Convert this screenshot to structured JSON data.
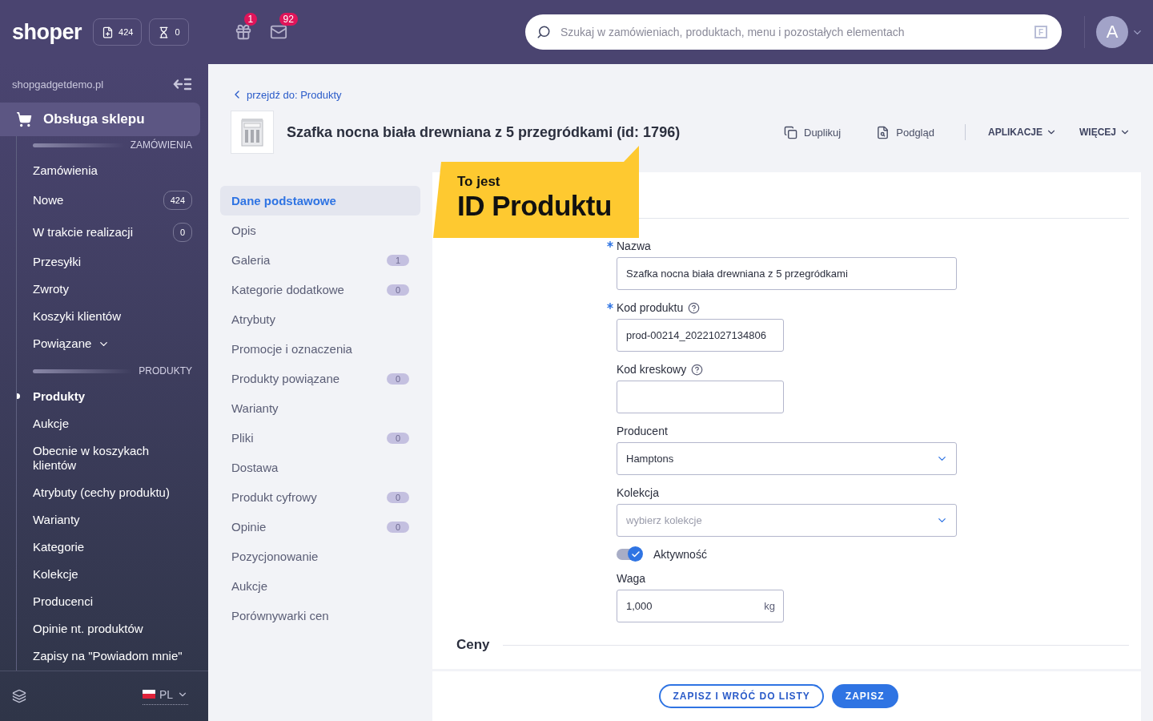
{
  "topbar": {
    "logo": "shoper",
    "counters": [
      {
        "kind": "orders",
        "count": "424"
      },
      {
        "kind": "pending",
        "count": "0"
      }
    ],
    "notifications": [
      {
        "kind": "gift",
        "badge": "1"
      },
      {
        "kind": "mail",
        "badge": "92"
      }
    ],
    "search": {
      "placeholder": "Szukaj w zamówieniach, produktach, menu i pozostałych elementach",
      "shortcut": "F"
    },
    "avatar": "A"
  },
  "sidebar": {
    "shop": "shopgadgetdemo.pl",
    "section": "Obsługa sklepu",
    "groups": [
      {
        "heading": "ZAMÓWIENIA",
        "items": [
          {
            "label": "Zamówienia",
            "selected": false
          },
          {
            "label": "Nowe",
            "badge": "424",
            "selected": false
          },
          {
            "label": "W trakcie realizacji",
            "badge": "0",
            "selected": false
          },
          {
            "label": "Przesyłki",
            "selected": false
          },
          {
            "label": "Zwroty",
            "selected": false
          },
          {
            "label": "Koszyki klientów",
            "selected": false
          },
          {
            "label": "Powiązane",
            "expandable": true,
            "selected": false
          }
        ]
      },
      {
        "heading": "PRODUKTY",
        "items": [
          {
            "label": "Produkty",
            "selected": true
          },
          {
            "label": "Aukcje",
            "selected": false
          },
          {
            "label": "Obecnie w koszykach klientów",
            "selected": false
          },
          {
            "label": "Atrybuty (cechy produktu)",
            "selected": false
          },
          {
            "label": "Warianty",
            "selected": false
          },
          {
            "label": "Kategorie",
            "selected": false
          },
          {
            "label": "Kolekcje",
            "selected": false
          },
          {
            "label": "Producenci",
            "selected": false
          },
          {
            "label": "Opinie nt. produktów",
            "selected": false
          },
          {
            "label": "Zapisy na \"Powiadom mnie\"",
            "selected": false
          }
        ]
      }
    ],
    "language": "PL"
  },
  "page": {
    "back_link": "przejdź do: Produkty",
    "title": "Szafka nocna biała drewniana z 5 przegródkami (id: 1796)",
    "actions": [
      {
        "kind": "duplicate",
        "label": "Duplikuj"
      },
      {
        "kind": "preview",
        "label": "Podgląd"
      }
    ],
    "menus": [
      "APLIKACJE",
      "WIĘCEJ"
    ],
    "callout": {
      "line_1": "To jest",
      "line_2": "ID Produktu"
    },
    "tabs": [
      {
        "label": "Dane podstawowe",
        "selected": true
      },
      {
        "label": "Opis",
        "selected": false
      },
      {
        "label": "Galeria",
        "badge": "1",
        "selected": false
      },
      {
        "label": "Kategorie dodatkowe",
        "badge": "0",
        "selected": false
      },
      {
        "label": "Atrybuty",
        "selected": false
      },
      {
        "label": "Promocje i oznaczenia",
        "selected": false
      },
      {
        "label": "Produkty powiązane",
        "badge": "0",
        "selected": false
      },
      {
        "label": "Warianty",
        "selected": false
      },
      {
        "label": "Pliki",
        "badge": "0",
        "selected": false
      },
      {
        "label": "Dostawa",
        "selected": false
      },
      {
        "label": "Produkt cyfrowy",
        "badge": "0",
        "selected": false
      },
      {
        "label": "Opinie",
        "badge": "0",
        "selected": false
      },
      {
        "label": "Pozycjonowanie",
        "selected": false
      },
      {
        "label": "Aukcje",
        "selected": false
      },
      {
        "label": "Porównywarki cen",
        "selected": false
      }
    ],
    "fields": [
      {
        "kind": "text",
        "label": "Nazwa",
        "required": true,
        "help": false,
        "value": "Szafka nocna biała drewniana z 5 przegródkami"
      },
      {
        "kind": "text",
        "label": "Kod produktu",
        "required": true,
        "help": true,
        "value": "prod-00214_20221027134806"
      },
      {
        "kind": "text",
        "label": "Kod kreskowy",
        "required": false,
        "help": true
      },
      {
        "kind": "select",
        "label": "Producent",
        "required": false,
        "help": false,
        "value": "Hamptons"
      },
      {
        "kind": "select",
        "label": "Kolekcja",
        "required": false,
        "help": false,
        "placeholder": "wybierz kolekcje"
      },
      {
        "kind": "toggle",
        "label": "Aktywność",
        "on": true
      },
      {
        "kind": "unit",
        "label": "Waga",
        "required": false,
        "help": false,
        "value": "1,000",
        "unit": "kg"
      }
    ],
    "next_section": "Ceny",
    "buttons": [
      {
        "kind": "secondary",
        "label": "ZAPISZ I WRÓĆ DO LISTY"
      },
      {
        "kind": "primary",
        "label": "ZAPISZ"
      }
    ]
  }
}
